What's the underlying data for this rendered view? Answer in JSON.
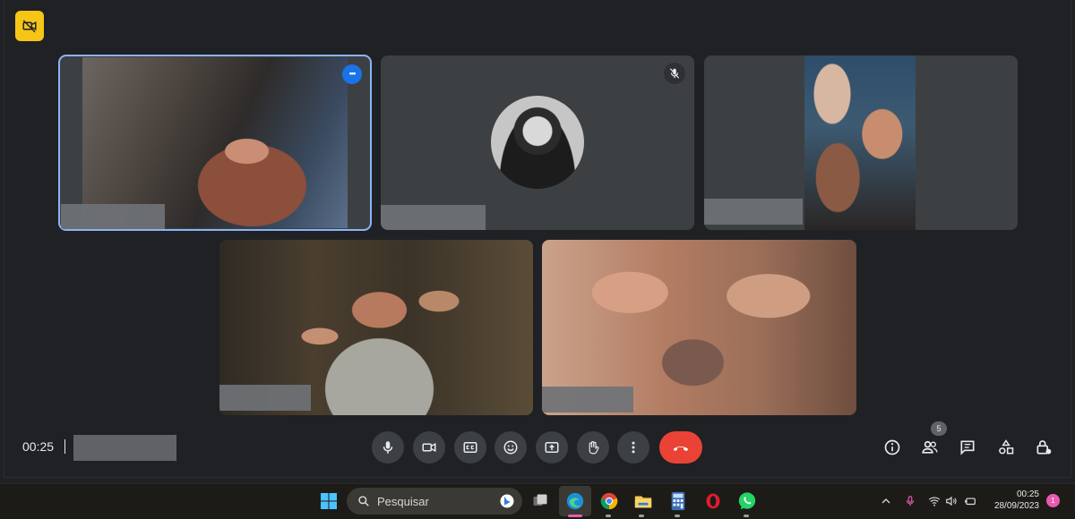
{
  "meeting": {
    "elapsed": "00:25",
    "participant_count": "5",
    "tile_more_glyph": "•••"
  },
  "controls": [
    {
      "name": "mic-button",
      "icon": "mic-icon"
    },
    {
      "name": "camera-button",
      "icon": "camera-icon"
    },
    {
      "name": "captions-button",
      "icon": "captions-icon"
    },
    {
      "name": "reactions-button",
      "icon": "emoji-icon"
    },
    {
      "name": "present-button",
      "icon": "present-icon"
    },
    {
      "name": "raise-hand-button",
      "icon": "hand-icon"
    },
    {
      "name": "more-options-button",
      "icon": "more-vert-icon"
    },
    {
      "name": "leave-call-button",
      "icon": "end-call-icon"
    }
  ],
  "side_controls": [
    {
      "name": "meeting-details-button",
      "icon": "info-icon"
    },
    {
      "name": "people-button",
      "icon": "people-icon"
    },
    {
      "name": "chat-button",
      "icon": "chat-icon"
    },
    {
      "name": "activities-button",
      "icon": "shapes-icon"
    },
    {
      "name": "host-controls-button",
      "icon": "lock-icon"
    }
  ],
  "taskbar": {
    "search_placeholder": "Pesquisar",
    "time": "00:25",
    "date": "28/09/2023",
    "notifications": "1",
    "apps": [
      "start-icon",
      "search-icon",
      "bing-icon",
      "task-view-icon",
      "edge-icon",
      "chrome-icon",
      "file-explorer-icon",
      "calculator-icon",
      "opera-icon",
      "whatsapp-icon"
    ]
  },
  "colors": {
    "background": "#202124",
    "tile": "#3c4043",
    "active_outline": "#8ab4f8",
    "end_call": "#ea4335",
    "warning_badge": "#f5c518",
    "taskbar": "#1c1b17"
  }
}
